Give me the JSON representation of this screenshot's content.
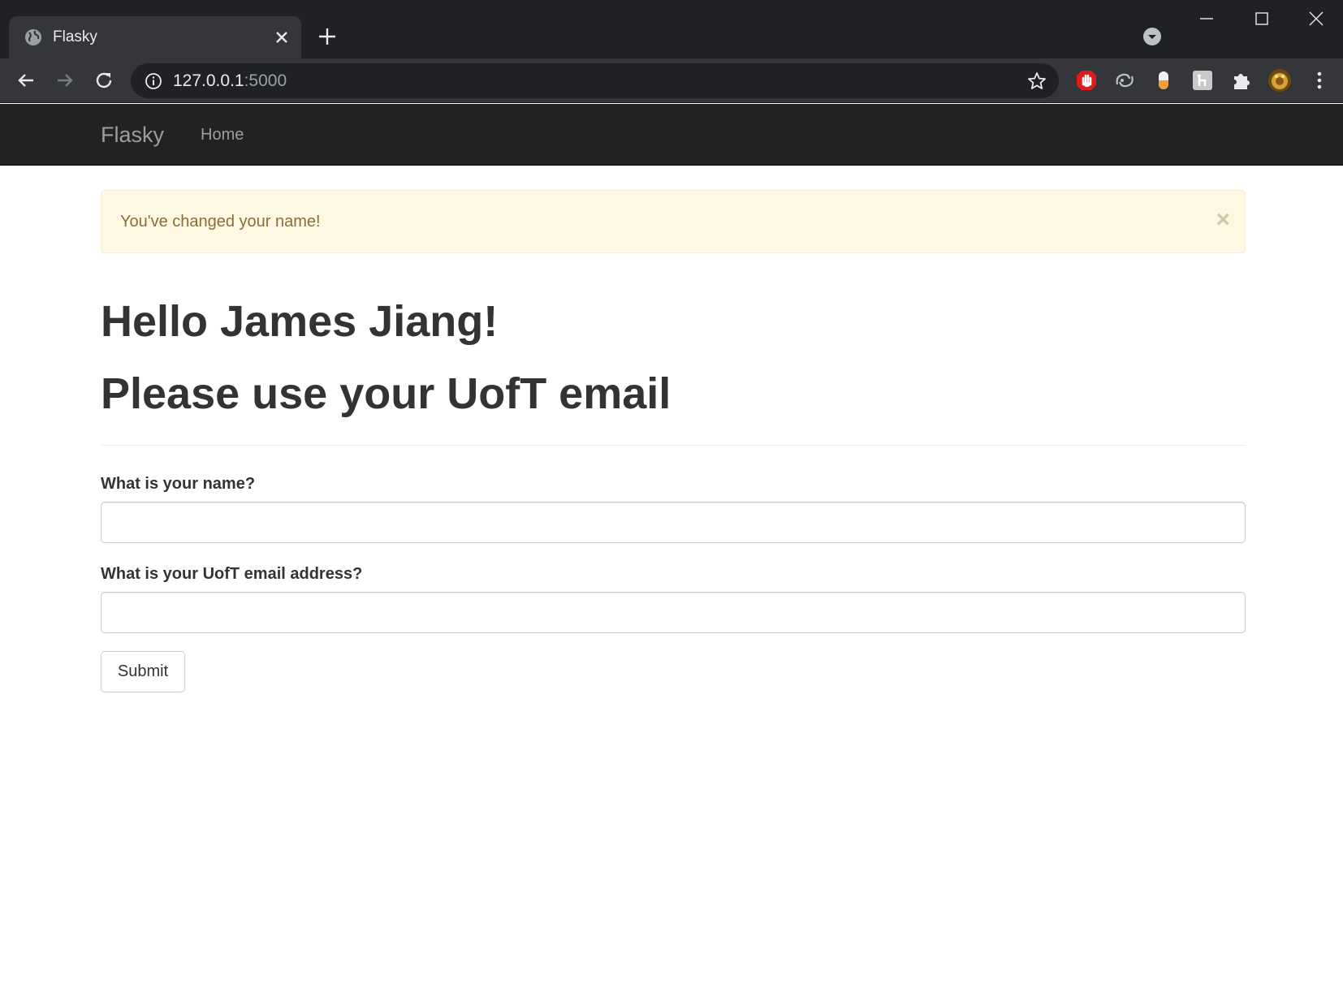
{
  "browser": {
    "tab": {
      "title": "Flasky",
      "favicon": "globe-icon"
    },
    "address_bar": {
      "host": "127.0.0.1",
      "port": ":5000"
    },
    "extensions": [
      "stop-hand-icon",
      "translate-icon",
      "pill-icon",
      "h-icon",
      "puzzle-icon",
      "profile-avatar"
    ]
  },
  "navbar": {
    "brand": "Flasky",
    "home": "Home",
    "bg_color": "#222222"
  },
  "alert": {
    "message": "You've changed your name!",
    "close": "×"
  },
  "main": {
    "greeting": "Hello James Jiang!",
    "instruction": "Please use your UofT email"
  },
  "form": {
    "name_label": "What is your name?",
    "name_value": "",
    "email_label": "What is your UofT email address?",
    "email_value": "",
    "submit_label": "Submit"
  }
}
